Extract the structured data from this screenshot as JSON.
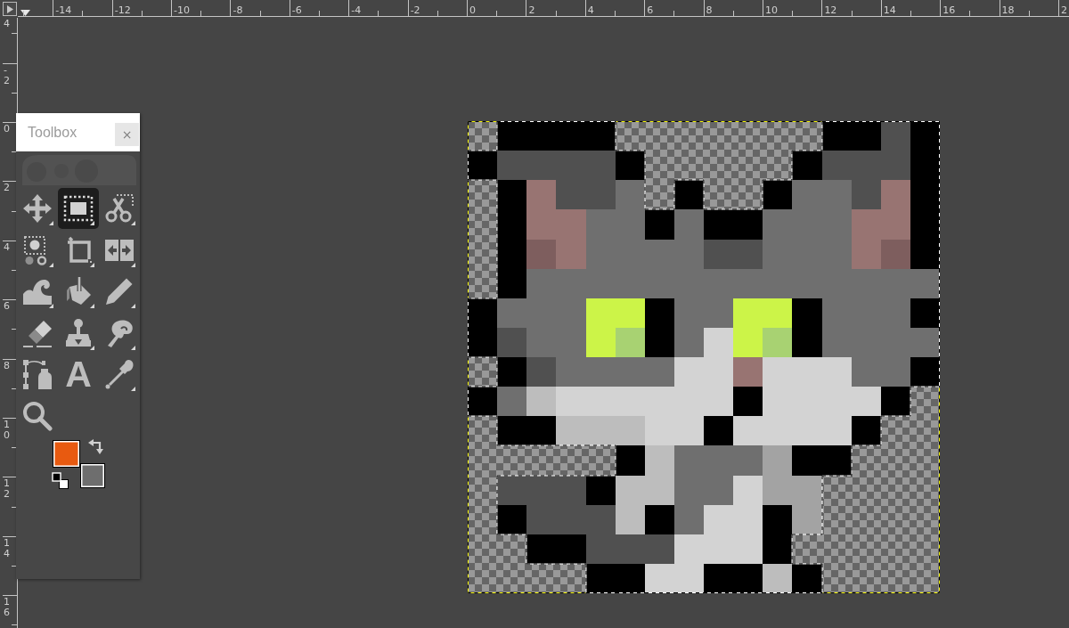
{
  "top_ruler": {
    "labels": [
      "-14",
      "-12",
      "-10",
      "-8",
      "-6",
      "-4",
      "-2",
      "0",
      "2",
      "4",
      "6",
      "8",
      "10",
      "12",
      "14",
      "16",
      "18",
      "2"
    ]
  },
  "left_ruler": {
    "labels": [
      "4",
      "-2",
      "0",
      "2",
      "4",
      "6",
      "8",
      "10",
      "12",
      "14",
      "16"
    ]
  },
  "toolbox": {
    "title": "Toolbox",
    "close": "×",
    "tools": [
      {
        "kind": "move",
        "grouped": true,
        "selected": false
      },
      {
        "kind": "rect-select",
        "grouped": true,
        "selected": true
      },
      {
        "kind": "scissors-select",
        "grouped": true,
        "selected": false
      },
      {
        "kind": "fuzzy-select",
        "grouped": true,
        "selected": false
      },
      {
        "kind": "crop",
        "grouped": true,
        "selected": false
      },
      {
        "kind": "flip",
        "grouped": true,
        "selected": false
      },
      {
        "kind": "warp",
        "grouped": true,
        "selected": false
      },
      {
        "kind": "bucket",
        "grouped": true,
        "selected": false
      },
      {
        "kind": "pencil",
        "grouped": true,
        "selected": false
      },
      {
        "kind": "eraser",
        "grouped": false,
        "selected": false
      },
      {
        "kind": "clone",
        "grouped": true,
        "selected": false
      },
      {
        "kind": "smudge",
        "grouped": true,
        "selected": false
      },
      {
        "kind": "paths",
        "grouped": false,
        "selected": false
      },
      {
        "kind": "text",
        "glyph": "A",
        "grouped": false,
        "selected": false
      },
      {
        "kind": "picker",
        "grouped": true,
        "selected": false
      },
      {
        "kind": "zoom",
        "grouped": false,
        "selected": false
      }
    ],
    "colors": [
      {
        "kind": "foreground",
        "color": "#e85a10"
      },
      {
        "kind": "background",
        "color": "#6e6e6e"
      }
    ]
  }
}
